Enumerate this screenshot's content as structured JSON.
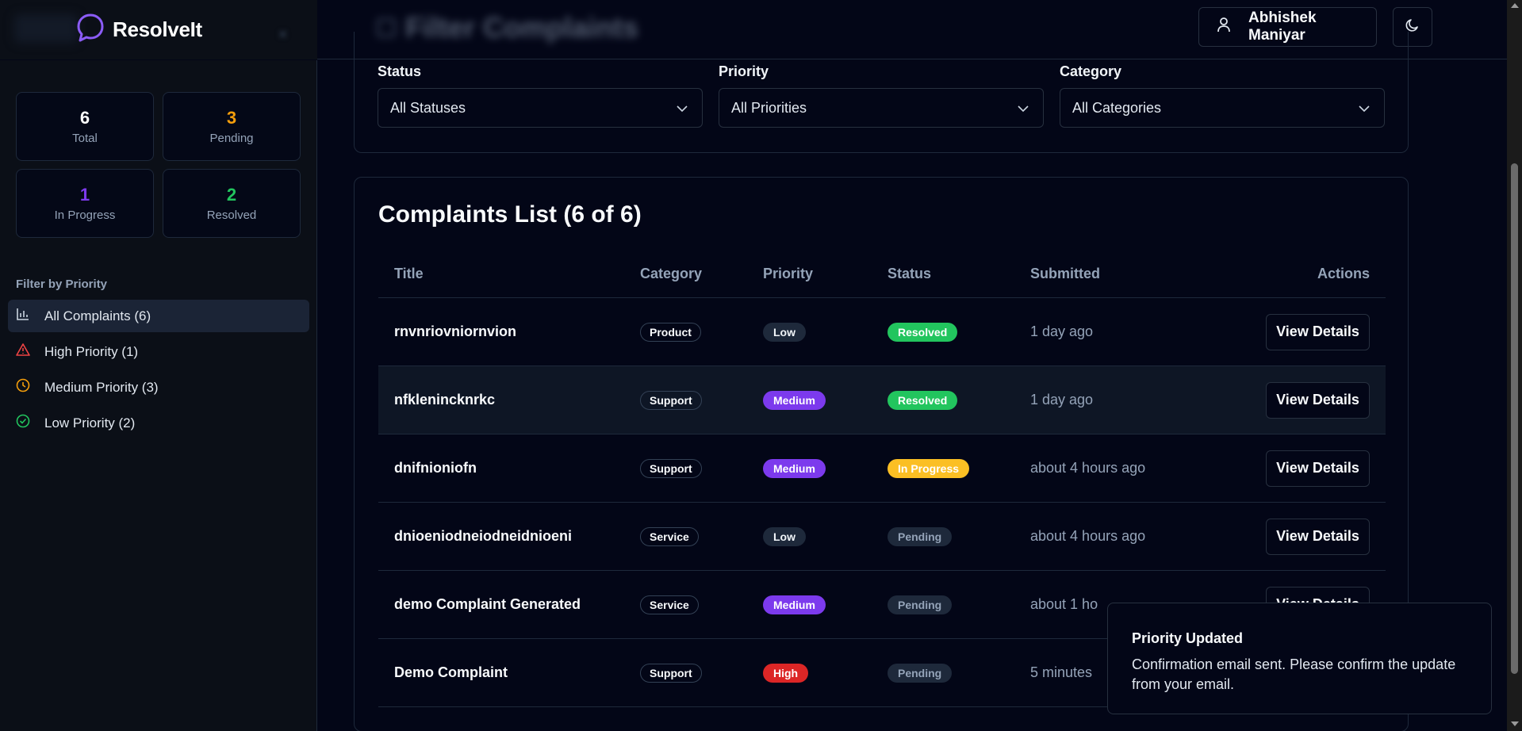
{
  "app": {
    "name": "ResolveIt",
    "page_title": "Filter Complaints"
  },
  "header": {
    "user_name": "Abhishek Maniyar"
  },
  "stats": [
    {
      "value": "6",
      "label": "Total",
      "color": "#ffffff"
    },
    {
      "value": "3",
      "label": "Pending",
      "color": "#f59e0b"
    },
    {
      "value": "1",
      "label": "In Progress",
      "color": "#7c3aed"
    },
    {
      "value": "2",
      "label": "Resolved",
      "color": "#22c55e"
    }
  ],
  "sidebar": {
    "filter_title": "Filter by Priority",
    "items": [
      {
        "label": "All Complaints (6)",
        "icon": "bar-chart-icon",
        "color": "#cbd5e1"
      },
      {
        "label": "High Priority (1)",
        "icon": "alert-triangle-icon",
        "color": "#ef4444"
      },
      {
        "label": "Medium Priority (3)",
        "icon": "clock-icon",
        "color": "#f59e0b"
      },
      {
        "label": "Low Priority (2)",
        "icon": "check-circle-icon",
        "color": "#22c55e"
      }
    ]
  },
  "filters": {
    "status": {
      "label": "Status",
      "value": "All Statuses"
    },
    "priority": {
      "label": "Priority",
      "value": "All Priorities"
    },
    "category": {
      "label": "Category",
      "value": "All Categories"
    }
  },
  "list": {
    "title": "Complaints List (6 of 6)",
    "columns": {
      "title": "Title",
      "category": "Category",
      "priority": "Priority",
      "status": "Status",
      "submitted": "Submitted",
      "actions": "Actions"
    },
    "action_label": "View Details",
    "rows": [
      {
        "title": "rnvnriovniornvion",
        "category": "Product",
        "priority": "Low",
        "status": "Resolved",
        "submitted": "1 day ago",
        "action": "View Details"
      },
      {
        "title": "nfklenincknrkc",
        "category": "Support",
        "priority": "Medium",
        "status": "Resolved",
        "submitted": "1 day ago",
        "action": "View Details"
      },
      {
        "title": "dnifnioniofn",
        "category": "Support",
        "priority": "Medium",
        "status": "In Progress",
        "submitted": "about 4 hours ago",
        "action": "View Details"
      },
      {
        "title": "dnioeniodneiodneidnioeni",
        "category": "Service",
        "priority": "Low",
        "status": "Pending",
        "submitted": "about 4 hours ago",
        "action": "View Details"
      },
      {
        "title": "demo Complaint Generated",
        "category": "Service",
        "priority": "Medium",
        "status": "Pending",
        "submitted": "about 1 ho",
        "action": "View Details"
      },
      {
        "title": "Demo Complaint",
        "category": "Support",
        "priority": "High",
        "status": "Pending",
        "submitted": "5 minutes",
        "action": ""
      }
    ]
  },
  "toast": {
    "title": "Priority Updated",
    "message": "Confirmation email sent. Please confirm the update from your email."
  },
  "colors": {
    "priority": {
      "Low": [
        "#1e293b",
        "#f1f5f9"
      ],
      "Medium": [
        "#7c3aed",
        "#ffffff"
      ],
      "High": [
        "#dc2626",
        "#ffffff"
      ]
    },
    "status": {
      "Resolved": [
        "#22c55e",
        "#ffffff"
      ],
      "In Progress": [
        "#fbbf24",
        "#ffffff"
      ],
      "Pending": [
        "#1e293b",
        "#94a3b8"
      ]
    }
  }
}
